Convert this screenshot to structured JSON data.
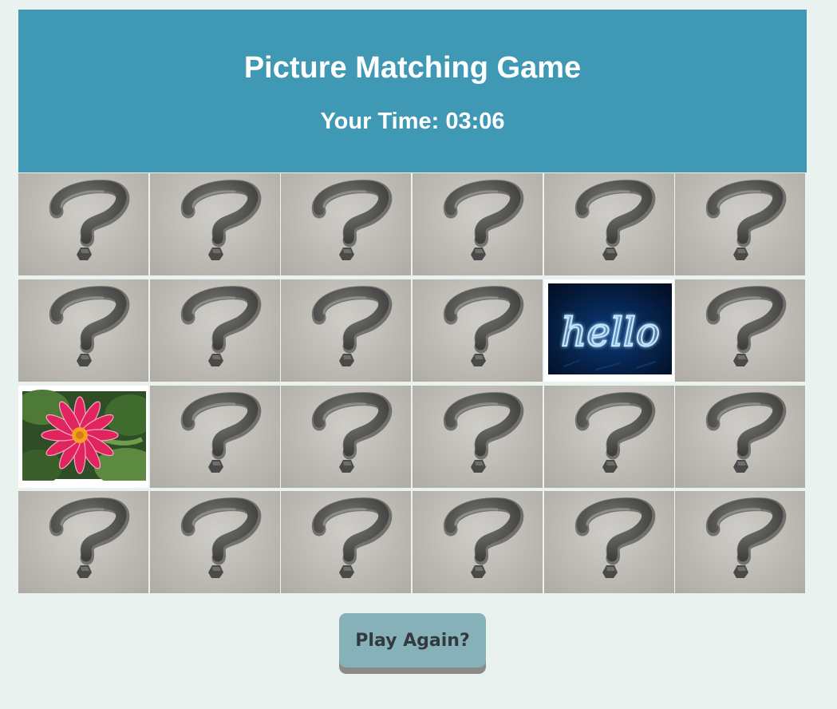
{
  "game": {
    "title": "Picture Matching Game",
    "timer_label": "Your Time:",
    "timer_value": "03:06",
    "timer_text": "Your Time: 03:06"
  },
  "board": {
    "rows": 4,
    "cols": 6,
    "cards": [
      {
        "state": "hidden",
        "icon": "question-mark-icon"
      },
      {
        "state": "hidden",
        "icon": "question-mark-icon"
      },
      {
        "state": "hidden",
        "icon": "question-mark-icon"
      },
      {
        "state": "hidden",
        "icon": "question-mark-icon"
      },
      {
        "state": "hidden",
        "icon": "question-mark-icon"
      },
      {
        "state": "hidden",
        "icon": "question-mark-icon"
      },
      {
        "state": "hidden",
        "icon": "question-mark-icon"
      },
      {
        "state": "hidden",
        "icon": "question-mark-icon"
      },
      {
        "state": "hidden",
        "icon": "question-mark-icon"
      },
      {
        "state": "hidden",
        "icon": "question-mark-icon"
      },
      {
        "state": "revealed",
        "image": "neon-hello-sign",
        "image_text": "hello"
      },
      {
        "state": "hidden",
        "icon": "question-mark-icon"
      },
      {
        "state": "revealed",
        "image": "pink-dahlia-flower"
      },
      {
        "state": "hidden",
        "icon": "question-mark-icon"
      },
      {
        "state": "hidden",
        "icon": "question-mark-icon"
      },
      {
        "state": "hidden",
        "icon": "question-mark-icon"
      },
      {
        "state": "hidden",
        "icon": "question-mark-icon"
      },
      {
        "state": "hidden",
        "icon": "question-mark-icon"
      },
      {
        "state": "hidden",
        "icon": "question-mark-icon"
      },
      {
        "state": "hidden",
        "icon": "question-mark-icon"
      },
      {
        "state": "hidden",
        "icon": "question-mark-icon"
      },
      {
        "state": "hidden",
        "icon": "question-mark-icon"
      },
      {
        "state": "hidden",
        "icon": "question-mark-icon"
      },
      {
        "state": "hidden",
        "icon": "question-mark-icon"
      }
    ]
  },
  "controls": {
    "play_again_label": "Play Again?"
  },
  "colors": {
    "page_background": "#e9f2ef",
    "header_background": "#3f98b4",
    "header_text": "#ffffff",
    "button_background": "#86b1b9",
    "button_shadow": "#8a8a8a",
    "button_text": "#333a3f",
    "neon_glow": "#4fb8ff",
    "flower_petal": "#e0245e"
  }
}
